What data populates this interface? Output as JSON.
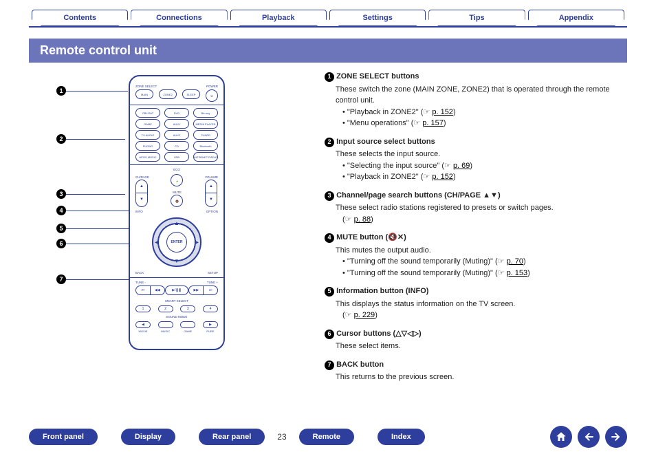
{
  "nav": {
    "contents": "Contents",
    "connections": "Connections",
    "playback": "Playback",
    "settings": "Settings",
    "tips": "Tips",
    "appendix": "Appendix"
  },
  "title": "Remote control unit",
  "remote": {
    "zone_select": "ZONE SELECT",
    "power": "POWER",
    "main": "MAIN",
    "zone2": "ZONE2",
    "sleep": "SLEEP",
    "pwr": "⏻",
    "cblsat": "CBL/SAT",
    "dvd": "DVD",
    "bluray": "Blu-ray",
    "game": "GAME",
    "aux1": "AUX1",
    "media": "MEDIA PLAYER",
    "tvaudio": "TV AUDIO",
    "aux2": "AUX2",
    "tuner": "TUNER",
    "phono": "PHONO",
    "cd": "CD",
    "bluetooth": "Bluetooth",
    "heos": "HEOS MUSIC",
    "usb": "USB",
    "inet": "INTERNET RADIO",
    "eco": "ECO",
    "chpage": "CH/PAGE",
    "mute": "MUTE",
    "volume": "VOLUME",
    "info": "INFO",
    "option": "OPTION",
    "enter": "ENTER",
    "back": "BACK",
    "setup": "SETUP",
    "tune_minus": "TUNE -",
    "tune_plus": "TUNE +",
    "prev": "⏮",
    "next": "⏭",
    "play": "▶/❚❚",
    "smart": "SMART SELECT",
    "s1": "1",
    "s2": "2",
    "s3": "3",
    "s4": "4",
    "sound_mode": "SOUND MODE",
    "movie": "MOVIE",
    "music": "MUSIC",
    "game_sm": "GAME",
    "pure": "PURE"
  },
  "items": [
    {
      "n": "1",
      "head": "ZONE SELECT buttons",
      "body": "These switch the zone (MAIN ZONE, ZONE2) that is operated through the remote control unit.",
      "links": [
        {
          "t": "\"Playback in ZONE2\"",
          "p": "p. 152"
        },
        {
          "t": "\"Menu operations\"",
          "p": "p. 157"
        }
      ]
    },
    {
      "n": "2",
      "head": "Input source select buttons",
      "body": "These selects the input source.",
      "links": [
        {
          "t": "\"Selecting the input source\"",
          "p": "p. 69"
        },
        {
          "t": "\"Playback in ZONE2\"",
          "p": "p. 152"
        }
      ]
    },
    {
      "n": "3",
      "head": "Channel/page search buttons (CH/PAGE ▲▼)",
      "body": "These select radio stations registered to presets or switch pages.",
      "links": [
        {
          "t": "",
          "p": "p. 88"
        }
      ]
    },
    {
      "n": "4",
      "head": "MUTE button (🔇✕)",
      "body": "This mutes the output audio.",
      "links": [
        {
          "t": "\"Turning off the sound temporarily (Muting)\"",
          "p": "p. 70"
        },
        {
          "t": "\"Turning off the sound temporarily (Muting)\"",
          "p": "p. 153"
        }
      ]
    },
    {
      "n": "5",
      "head": "Information button (INFO)",
      "body": "This displays the status information on the TV screen.",
      "links": [
        {
          "t": "",
          "p": "p. 229"
        }
      ]
    },
    {
      "n": "6",
      "head": "Cursor buttons (△▽◁▷)",
      "body": "These select items."
    },
    {
      "n": "7",
      "head": "BACK button",
      "body": "This returns to the previous screen."
    }
  ],
  "bottom": {
    "front": "Front panel",
    "display": "Display",
    "rear": "Rear panel",
    "page": "23",
    "remote": "Remote",
    "index": "Index"
  }
}
